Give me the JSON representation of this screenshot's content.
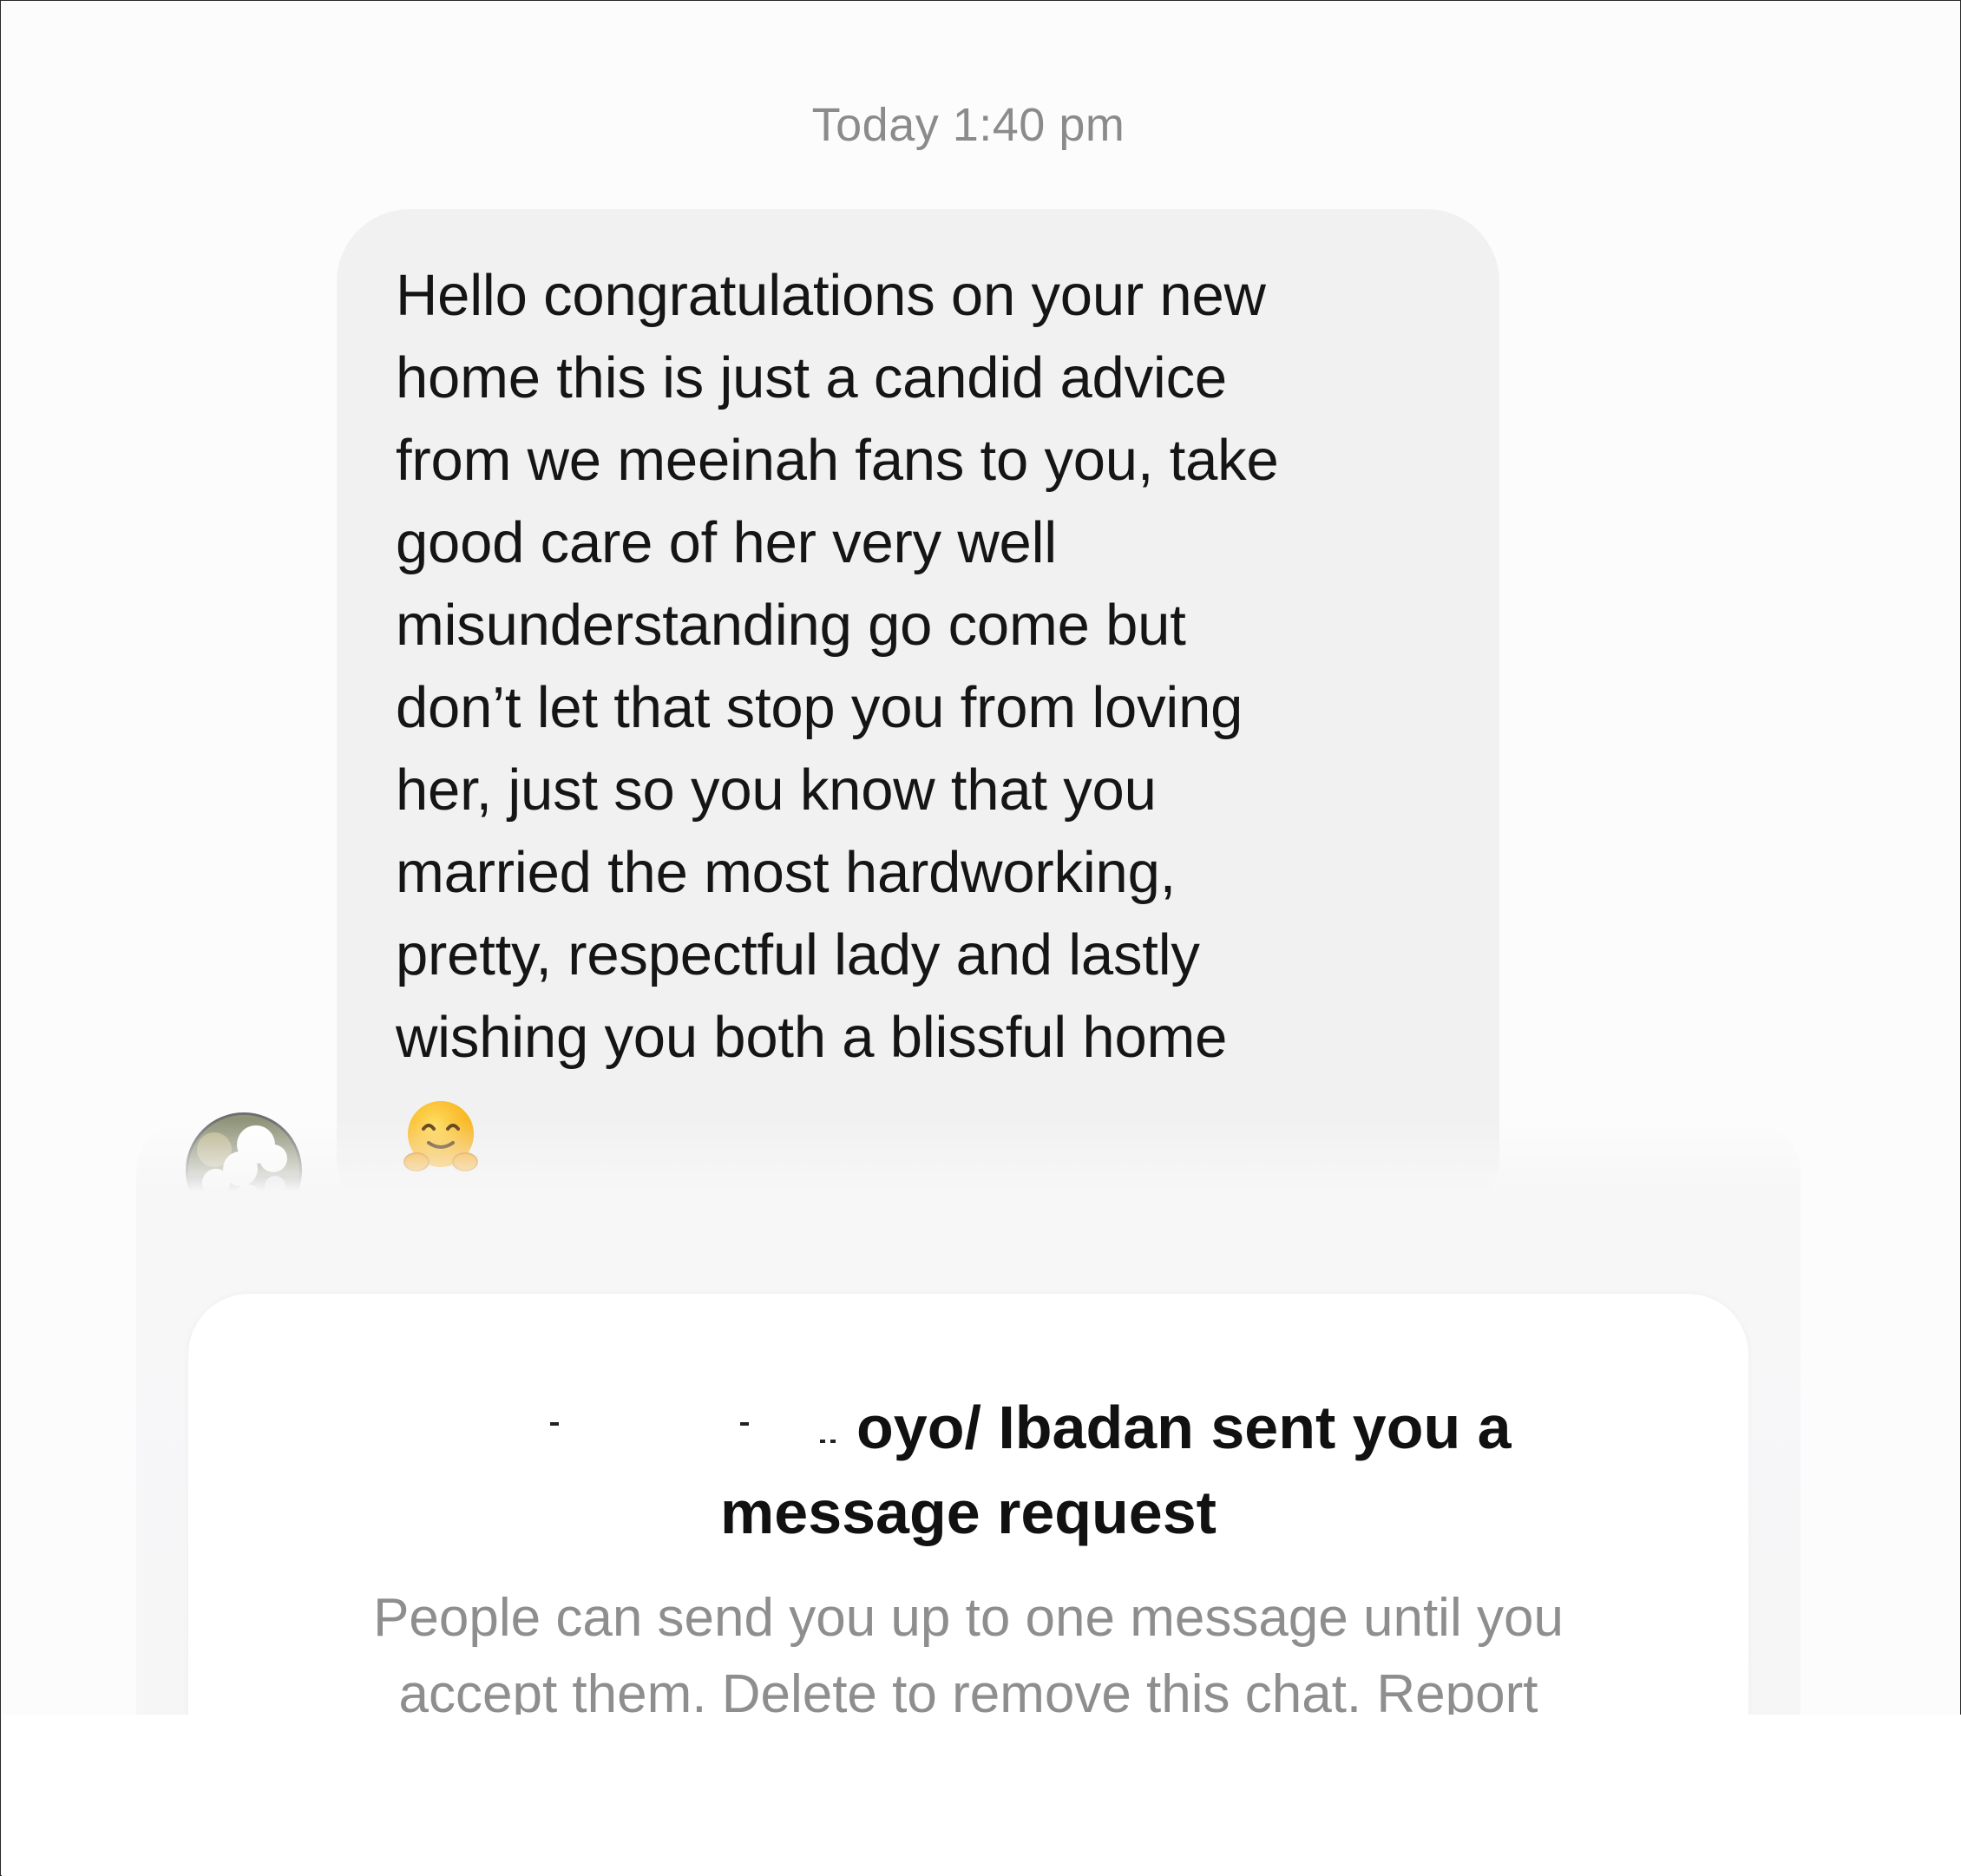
{
  "chat": {
    "timestamp": "Today 1:40 pm",
    "message": {
      "text": "Hello congratulations on your new\nhome this is just a candid advice\nfrom we meeinah fans to you, take\ngood care of her very well\nmisunderstanding go come but\ndon’t let that stop you from loving\nher, just so you know that you\nmarried the most hardworking,\npretty, respectful lady and lastly\nwishing you both a blissful home",
      "emoji_icon": "hugging-face-icon"
    },
    "avatar_icon": "sender-avatar-icon"
  },
  "request_card": {
    "title_line1": "oyo/ Ibadan sent you a",
    "title_line2": "message request",
    "body": "People can send you up to one message until you\naccept them. Delete to remove this chat. Report"
  },
  "colors": {
    "bubble_bg": "#f1f1f2",
    "timestamp": "#8b8b8b",
    "body_text": "#8e8e8e"
  }
}
